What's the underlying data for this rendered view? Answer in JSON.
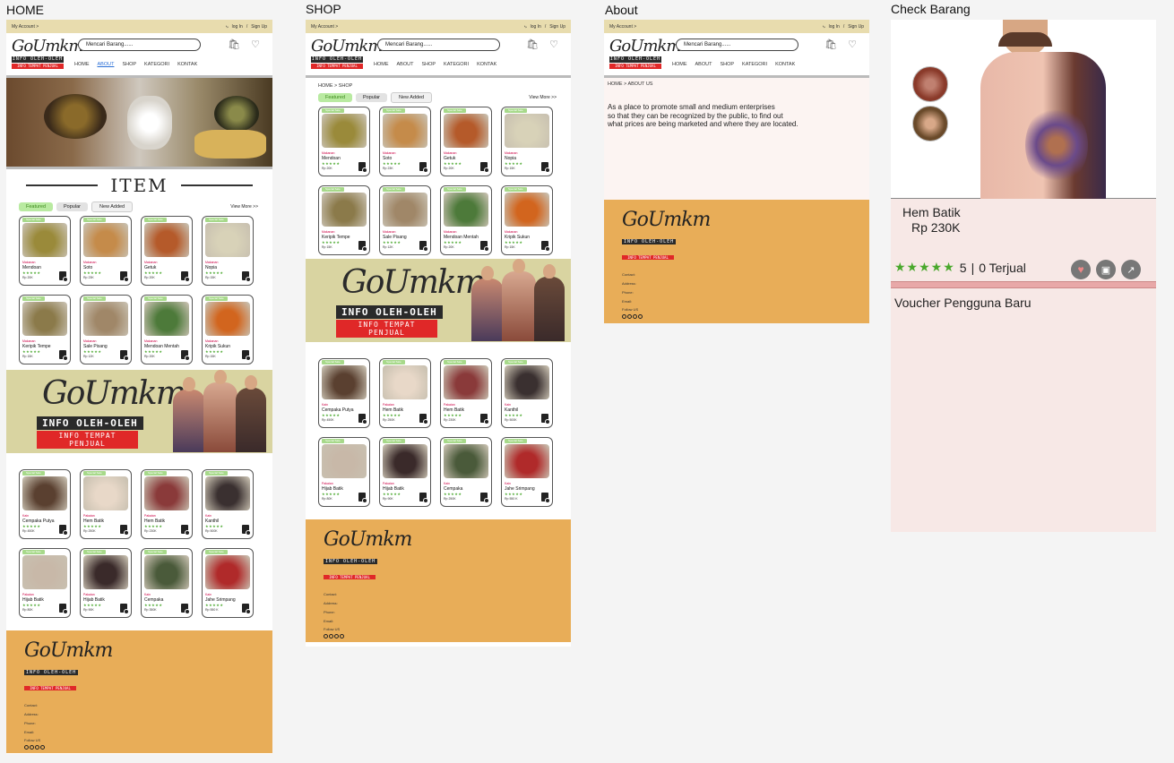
{
  "frames": {
    "home": "HOME",
    "shop": "SHOP",
    "about": "About",
    "check": "Check Barang"
  },
  "header": {
    "my_account": "My Account >",
    "login": "log In",
    "sep": "/",
    "signup": "Sign Up",
    "search_placeholder": "Mencari Barang......",
    "nav": [
      "HOME",
      "ABOUT",
      "SHOP",
      "KATEGORI",
      "KONTAK"
    ]
  },
  "brand": {
    "script": "GoUmkm",
    "line1": "INFO OLEH-OLEH",
    "line2": "INFO TEMPAT PENJUAL"
  },
  "home": {
    "item_title": "ITEM"
  },
  "tabs": {
    "featured": "Featured",
    "popular": "Popular",
    "new_added": "New Added",
    "view_more": "View More >>"
  },
  "badge": "Special Sale",
  "stars": "★★★★★",
  "food_products": [
    {
      "category": "Makanan",
      "name": "Mendoan",
      "price": "Rp 20K",
      "color": "#9a8a3a"
    },
    {
      "category": "Makanan",
      "name": "Soto",
      "price": "Rp 23K",
      "color": "#c58b4a"
    },
    {
      "category": "Makanan",
      "name": "Getuk",
      "price": "Rp 20K",
      "color": "#b55a2a"
    },
    {
      "category": "Makanan",
      "name": "Nopia",
      "price": "Rp 15K",
      "color": "#d8d2b8"
    },
    {
      "category": "Makanan",
      "name": "Keripik Tempe",
      "price": "Rp 15K",
      "color": "#8b7a4a"
    },
    {
      "category": "Makanan",
      "name": "Sale Pisang",
      "price": "Rp 12K",
      "color": "#a08768"
    },
    {
      "category": "Makanan",
      "name": "Mendoan Mentah",
      "price": "Rp 20K",
      "color": "#4d7a3a"
    },
    {
      "category": "Makanan",
      "name": "Kripik Sukun",
      "price": "Rp 15K",
      "color": "#d2651e"
    }
  ],
  "batik_products": [
    {
      "category": "Kain",
      "name": "Cempaka Putya",
      "price": "Rp 450K",
      "color": "#5a4030"
    },
    {
      "category": "Pakaian",
      "name": "Hem Batik",
      "price": "Rp 250K",
      "color": "#e8d8c8"
    },
    {
      "category": "Pakaian",
      "name": "Hem Batik",
      "price": "Rp 230K",
      "color": "#8a3a3a"
    },
    {
      "category": "Kain",
      "name": "Kanthil",
      "price": "Rp 500K",
      "color": "#3a3030"
    },
    {
      "category": "Pakaian",
      "name": "Hijab Batik",
      "price": "Rp 80K",
      "color": "#c8b8a8"
    },
    {
      "category": "Pakaian",
      "name": "Hijab Batik",
      "price": "Rp 90K",
      "color": "#3a2a2a"
    },
    {
      "category": "Kain",
      "name": "Cempaka",
      "price": "Rp 350K",
      "color": "#4a5a3a"
    },
    {
      "category": "Kain",
      "name": "Jahe Srimpang",
      "price": "Rp 550 K",
      "color": "#b02a2a"
    }
  ],
  "shop_batik_products": [
    {
      "category": "Kain",
      "name": "Cempaka Putya",
      "price": "Rp 450K",
      "color": "#5a4030"
    },
    {
      "category": "Pakaian",
      "name": "Hem Batik",
      "price": "Rp 250K",
      "color": "#e8d8c8"
    },
    {
      "category": "Pakaian",
      "name": "Hem Batik",
      "price": "Rp 230K",
      "color": "#8a3a3a"
    },
    {
      "category": "Kain",
      "name": "Kanthil",
      "price": "Rp 500K",
      "color": "#3a3030"
    },
    {
      "category": "Pakaian",
      "name": "Hijab Batik",
      "price": "Rp 80K",
      "color": "#c8b8a8"
    },
    {
      "category": "Pakaian",
      "name": "Hijab Batik",
      "price": "Rp 90K",
      "color": "#3a2a2a"
    },
    {
      "category": "Kain",
      "name": "Cempaka",
      "price": "Rp 250K",
      "color": "#4a5a3a"
    },
    {
      "category": "Kain",
      "name": "Jahe Srimpang",
      "price": "Rp 550 K",
      "color": "#b02a2a"
    }
  ],
  "footer": {
    "contact": "Contact:",
    "address": "Address:",
    "phone": "Phone:",
    "email": "Email:",
    "follow": "Follow US"
  },
  "shop": {
    "breadcrumb": "HOME > SHOP"
  },
  "about": {
    "breadcrumb": "HOME  >  ABOUT US",
    "lines": [
      "As a place to promote small and medium enterprises",
      "so that they can be recognized by the public, to find out",
      "what prices are being marketed and where they are located."
    ]
  },
  "check": {
    "product_name": "Hem Batik",
    "price": "Rp 230K",
    "stars": "★★★★★",
    "rating": "5",
    "divider": "|",
    "sold": "0 Terjual",
    "voucher": "Voucher Pengguna Baru"
  },
  "colors": {
    "topbar": "#e8dcae",
    "footer": "#e8ad58",
    "banner": "#d9d4a1",
    "featured": "#b9eaa1",
    "star": "#49a82c",
    "red": "#e02828"
  }
}
